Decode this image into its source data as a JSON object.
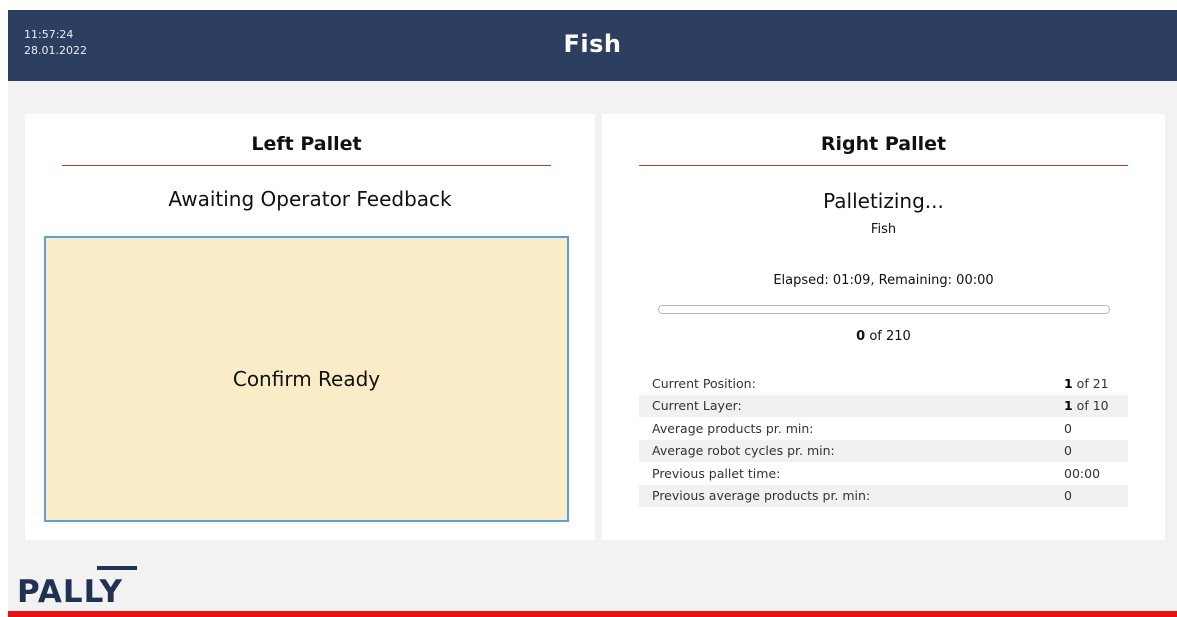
{
  "header": {
    "time": "11:57:24",
    "date": "28.01.2022",
    "title": "Fish"
  },
  "left_pallet": {
    "title": "Left Pallet",
    "status": "Awaiting Operator Feedback",
    "confirm_label": "Confirm Ready"
  },
  "right_pallet": {
    "title": "Right Pallet",
    "status": "Palletizing...",
    "product": "Fish",
    "timing": "Elapsed: 01:09,  Remaining: 00:00",
    "progress_fraction": 0,
    "count_done": "0",
    "count_total_text": " of 210",
    "stats": [
      {
        "label": "Current Position:",
        "value_bold": "1",
        "value_rest": " of 21"
      },
      {
        "label": "Current Layer:",
        "value_bold": "1",
        "value_rest": " of 10"
      },
      {
        "label": "Average products pr. min:",
        "value_bold": "",
        "value_rest": "0"
      },
      {
        "label": "Average robot cycles pr. min:",
        "value_bold": "",
        "value_rest": "0"
      },
      {
        "label": "Previous pallet time:",
        "value_bold": "",
        "value_rest": "00:00"
      },
      {
        "label": "Previous average products pr. min:",
        "value_bold": "",
        "value_rest": "0"
      }
    ]
  },
  "brand": {
    "logo_text": "PALLY",
    "logo_color": "#1f3254",
    "accent_color": "#e41414"
  }
}
